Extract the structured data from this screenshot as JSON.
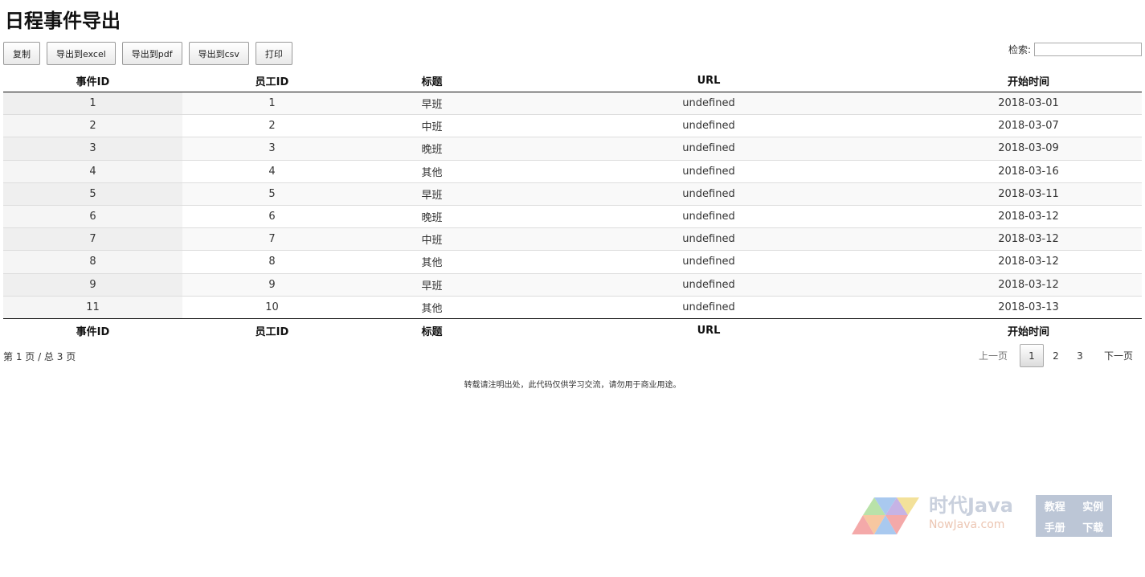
{
  "page": {
    "title": "日程事件导出"
  },
  "toolbar": {
    "buttons": [
      "复制",
      "导出到excel",
      "导出到pdf",
      "导出到csv",
      "打印"
    ]
  },
  "search": {
    "label": "检索:",
    "value": ""
  },
  "table": {
    "columns": [
      "事件ID",
      "员工ID",
      "标题",
      "URL",
      "开始时间"
    ],
    "rows": [
      [
        "1",
        "1",
        "早班",
        "undefined",
        "2018-03-01"
      ],
      [
        "2",
        "2",
        "中班",
        "undefined",
        "2018-03-07"
      ],
      [
        "3",
        "3",
        "晚班",
        "undefined",
        "2018-03-09"
      ],
      [
        "4",
        "4",
        "其他",
        "undefined",
        "2018-03-16"
      ],
      [
        "5",
        "5",
        "早班",
        "undefined",
        "2018-03-11"
      ],
      [
        "6",
        "6",
        "晚班",
        "undefined",
        "2018-03-12"
      ],
      [
        "7",
        "7",
        "中班",
        "undefined",
        "2018-03-12"
      ],
      [
        "8",
        "8",
        "其他",
        "undefined",
        "2018-03-12"
      ],
      [
        "9",
        "9",
        "早班",
        "undefined",
        "2018-03-12"
      ],
      [
        "11",
        "10",
        "其他",
        "undefined",
        "2018-03-13"
      ]
    ]
  },
  "pagination": {
    "info": "第 1 页 / 总 3 页",
    "prev": "上一页",
    "pages": [
      "1",
      "2",
      "3"
    ],
    "current": "1",
    "next": "下一页"
  },
  "footer": {
    "note": "转载请注明出处，此代码仅供学习交流，请勿用于商业用途。"
  },
  "watermark": {
    "line1": "时代Java",
    "line2": "NowJava.com",
    "box": [
      "教程",
      "实例",
      "手册",
      "下载"
    ],
    "colors": [
      "#f4a9a9",
      "#f7c7a0",
      "#a9c9ef",
      "#b9e2a9",
      "#c6b3e5",
      "#f3e19a"
    ]
  }
}
